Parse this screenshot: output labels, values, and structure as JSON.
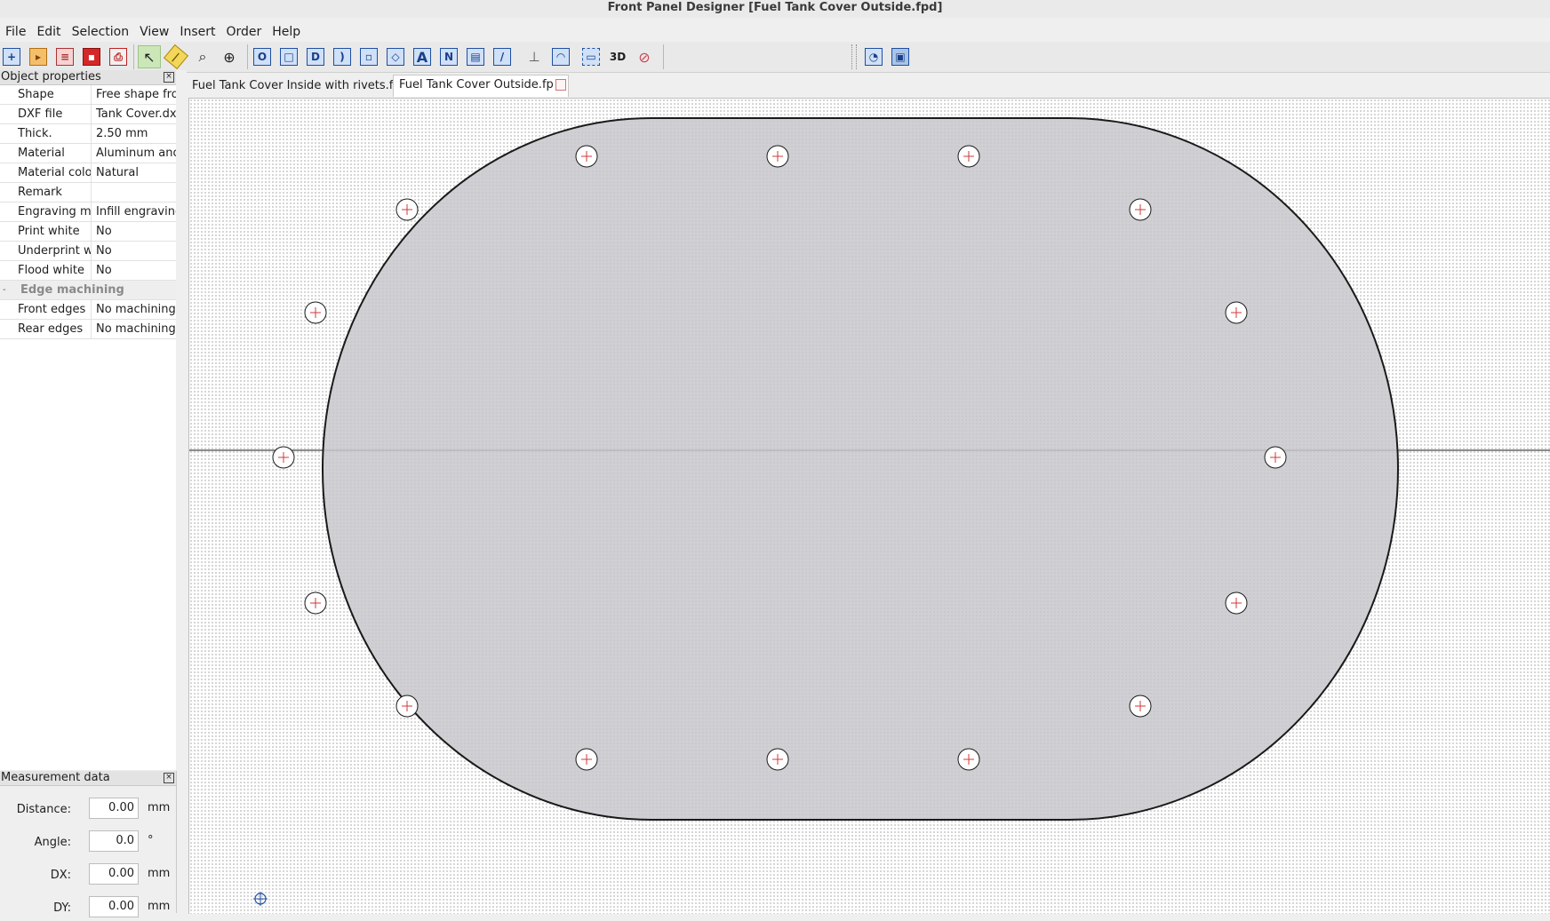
{
  "window": {
    "title": "Front Panel Designer [Fuel Tank Cover Outside.fpd]"
  },
  "menu": [
    "File",
    "Edit",
    "Selection",
    "View",
    "Insert",
    "Order",
    "Help"
  ],
  "toolbar": {
    "icons": [
      "new-icon",
      "open-icon",
      "import-icon",
      "save-icon",
      "print-icon",
      "pointer-icon",
      "measure-icon",
      "zoom-icon",
      "crosshair-icon",
      "drill-hole-icon",
      "rect-hole-icon",
      "d-hole-icon",
      "slot-icon",
      "rect-pocket-icon",
      "cavity-icon",
      "text-icon",
      "engraving-icon",
      "image-icon",
      "line-icon",
      "bolt-icon",
      "threaded-icon",
      "frame-icon",
      "view-3d-icon",
      "mark-icon"
    ],
    "text_3d": "3D",
    "right_icons": [
      "price-icon",
      "box-icon"
    ]
  },
  "object_properties": {
    "title": "Object properties",
    "rows": [
      {
        "key": "Shape",
        "value": "Free shape from"
      },
      {
        "key": "DXF file",
        "value": "Tank Cover.dxf"
      },
      {
        "key": "Thick.",
        "value": "2.50 mm"
      },
      {
        "key": "Material",
        "value": "Aluminum anod"
      },
      {
        "key": "Material colo",
        "value": "Natural"
      },
      {
        "key": "Remark",
        "value": ""
      },
      {
        "key": "Engraving m",
        "value": "Infill engraving"
      },
      {
        "key": "Print white",
        "value": "No"
      },
      {
        "key": "Underprint w",
        "value": "No"
      },
      {
        "key": "Flood white",
        "value": "No"
      }
    ],
    "section": {
      "toggle": "-",
      "label": "Edge machining"
    },
    "section_rows": [
      {
        "key": "Front edges",
        "value": "No machining"
      },
      {
        "key": "Rear edges",
        "value": "No machining"
      }
    ]
  },
  "measurement": {
    "title": "Measurement data",
    "rows": [
      {
        "label": "Distance:",
        "value": "0.00",
        "unit": "mm"
      },
      {
        "label": "Angle:",
        "value": "0.0",
        "unit": "°"
      },
      {
        "label": "DX:",
        "value": "0.00",
        "unit": "mm"
      },
      {
        "label": "DY:",
        "value": "0.00",
        "unit": "mm"
      }
    ]
  },
  "tabs": [
    {
      "label": "Fuel Tank Cover Inside with rivets.fpd",
      "active": false
    },
    {
      "label": "Fuel Tank Cover Outside.fp",
      "active": true
    }
  ],
  "colors": {
    "panel_fill": "#c8c8cc",
    "outline": "#1a1a1a",
    "hole_cross": "#d03a3a",
    "accent": "#1f4fa3"
  }
}
